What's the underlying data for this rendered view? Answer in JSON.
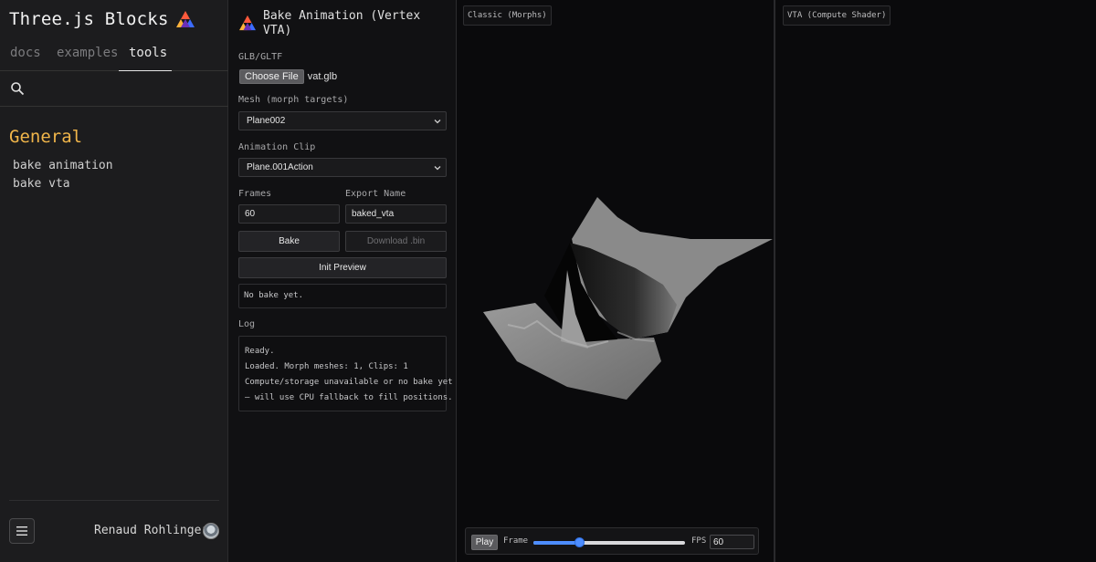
{
  "sidebar": {
    "brand_title": "Three.js Blocks",
    "brand_icon": "threejs-blocks-logo-icon",
    "tabs": [
      {
        "label": "docs",
        "active": false
      },
      {
        "label": "examples",
        "active": false
      },
      {
        "label": "tools",
        "active": true
      }
    ],
    "search": {
      "placeholder": "",
      "icon": "search-icon"
    },
    "section_title": "General",
    "links": [
      "bake animation",
      "bake vta"
    ],
    "menu_icon": "hamburger-menu-icon",
    "author": "Renaud Rohlinger"
  },
  "panel": {
    "title": "Bake Animation (Vertex VTA)",
    "file": {
      "label": "GLB/GLTF",
      "button": "Choose File",
      "filename": "vat.glb"
    },
    "mesh": {
      "label": "Mesh (morph targets)",
      "value": "Plane002"
    },
    "clip": {
      "label": "Animation Clip",
      "value": "Plane.001Action"
    },
    "frames": {
      "label": "Frames",
      "value": "60"
    },
    "export_name": {
      "label": "Export Name",
      "value": "baked_vta"
    },
    "buttons": {
      "bake": "Bake",
      "download": "Download .bin",
      "init_preview": "Init Preview"
    },
    "status": "No bake yet.",
    "log": {
      "label": "Log",
      "lines": [
        "Ready.",
        "Loaded. Morph meshes: 1, Clips: 1",
        "Compute/storage unavailable or no bake yet",
        "— will use CPU fallback to fill positions."
      ]
    }
  },
  "viewports": {
    "classic_label": "Classic (Morphs)",
    "vta_label": "VTA (Compute Shader)"
  },
  "playback": {
    "play_label": "Play",
    "frame_label": "Frame",
    "frame_progress": 0.3,
    "fps_label": "FPS",
    "fps_value": "60"
  },
  "colors": {
    "accent_section": "#f0b54a",
    "slider": "#4d8dff",
    "mesh_fill": "#7a7a7a"
  }
}
